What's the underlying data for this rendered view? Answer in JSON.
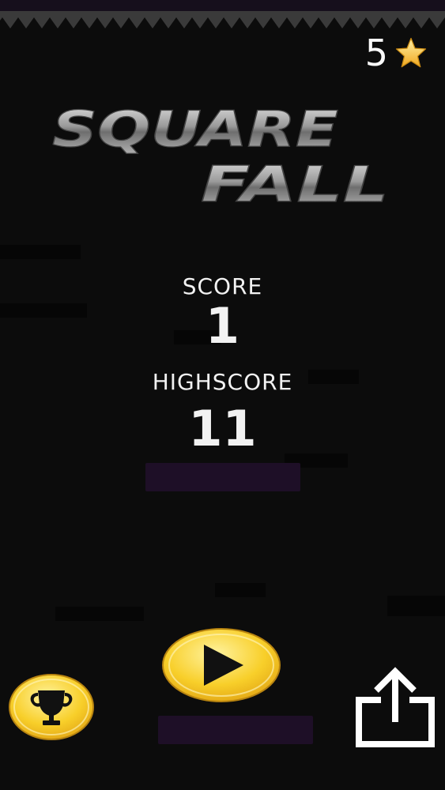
{
  "hud": {
    "stars_count": "5"
  },
  "logo": {
    "line1": "SQUARE",
    "line2": "FALL"
  },
  "score": {
    "label": "SCORE",
    "value": "1"
  },
  "highscore": {
    "label": "HIGHSCORE",
    "value": "11"
  },
  "icons": {
    "star": "star-icon",
    "play": "play-icon",
    "trophy": "trophy-icon",
    "share": "share-icon"
  },
  "colors": {
    "background": "#0c0c0c",
    "button_yellow": "#f5c518",
    "obstacle_purple": "#1e0f27",
    "text": "#f2f2f2"
  }
}
